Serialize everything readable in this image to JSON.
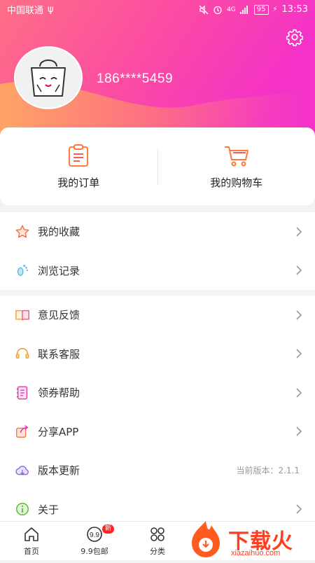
{
  "status_bar": {
    "carrier": "中国联通",
    "usb_glyph": "ψ",
    "network": "4G",
    "battery": "95",
    "time": "13:53"
  },
  "profile": {
    "phone": "186****5459"
  },
  "orders": {
    "my_orders": "我的订单",
    "my_cart": "我的购物车"
  },
  "menu_group_1": [
    {
      "label": "我的收藏",
      "icon": "star-icon"
    },
    {
      "label": "浏览记录",
      "icon": "footprint-icon"
    }
  ],
  "menu_group_2": [
    {
      "label": "意见反馈",
      "icon": "book-icon"
    },
    {
      "label": "联系客服",
      "icon": "headset-icon"
    },
    {
      "label": "领券帮助",
      "icon": "notebook-icon"
    },
    {
      "label": "分享APP",
      "icon": "share-icon"
    },
    {
      "label": "版本更新",
      "icon": "cloud-update-icon",
      "extra": "当前版本：2.1.1"
    },
    {
      "label": "关于",
      "icon": "info-icon"
    }
  ],
  "tabs": {
    "home": "首页",
    "nine_nine": "9.9包邮",
    "nine_nine_badge": "新",
    "category": "分类"
  },
  "watermark": {
    "text": "下载火",
    "sub": "xiazaihuo.com"
  },
  "colors": {
    "header_start": "#ff6a88",
    "header_end": "#f52fbf",
    "accent": "#ff4f6e"
  }
}
